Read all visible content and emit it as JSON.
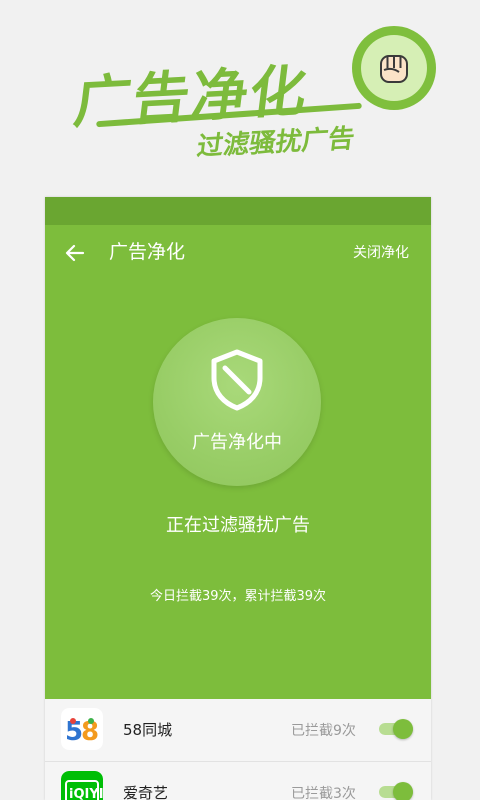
{
  "promo": {
    "headline": "广告净化",
    "subline": "过滤骚扰广告",
    "badge_icon": "fist-icon"
  },
  "toolbar": {
    "title": "广告净化",
    "close_label": "关闭净化",
    "back_icon": "back-arrow-icon"
  },
  "status": {
    "circle_label": "广告净化中",
    "shield_icon": "shield-icon",
    "main_text": "正在过滤骚扰广告",
    "sub_text": "今日拦截39次，累计拦截39次"
  },
  "apps": [
    {
      "name": "58同城",
      "blocked": "已拦截9次",
      "icon": "58-logo",
      "enabled": true
    },
    {
      "name": "爱奇艺",
      "blocked": "已拦截3次",
      "icon": "iqiyi-logo",
      "enabled": true
    }
  ],
  "colors": {
    "brand_green": "#7dbd3c",
    "status_bar": "#6aa631",
    "toggle_on": "#7dbd3c"
  }
}
